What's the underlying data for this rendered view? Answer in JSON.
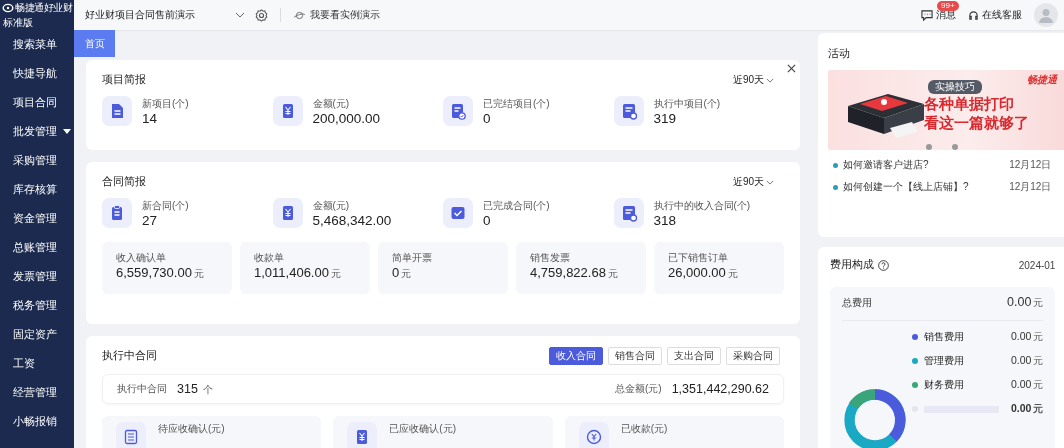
{
  "brand": {
    "name": "畅捷通好业财",
    "edition": "标准版"
  },
  "topbar": {
    "account": "好业财项目合同售前演示",
    "demo_link": "我要看实例演示",
    "messages": {
      "label": "消息",
      "badge": "99+"
    },
    "support": "在线客服"
  },
  "sidebar": {
    "items": [
      {
        "label": "搜索菜单",
        "expandable": false
      },
      {
        "label": "快捷导航",
        "expandable": false
      },
      {
        "label": "项目合同",
        "expandable": false
      },
      {
        "label": "批发管理",
        "expandable": true
      },
      {
        "label": "采购管理",
        "expandable": false
      },
      {
        "label": "库存核算",
        "expandable": false
      },
      {
        "label": "资金管理",
        "expandable": false
      },
      {
        "label": "总账管理",
        "expandable": false
      },
      {
        "label": "发票管理",
        "expandable": false
      },
      {
        "label": "税务管理",
        "expandable": false
      },
      {
        "label": "固定资产",
        "expandable": false
      },
      {
        "label": "工资",
        "expandable": false
      },
      {
        "label": "经营管理",
        "expandable": false
      },
      {
        "label": "小畅报销",
        "expandable": false
      }
    ]
  },
  "tabs": [
    {
      "label": "首页",
      "selected": true
    }
  ],
  "project_brief": {
    "title": "项目简报",
    "period": "近90天",
    "stats": [
      {
        "kind": "document",
        "label": "新项目(个)",
        "value": "14"
      },
      {
        "kind": "money",
        "label": "金额(元)",
        "value": "200,000.00"
      },
      {
        "kind": "checklist",
        "label": "已完结项目(个)",
        "value": "0"
      },
      {
        "kind": "form",
        "label": "执行中项目(个)",
        "value": "319"
      }
    ]
  },
  "contract_brief": {
    "title": "合同简报",
    "period": "近90天",
    "stats": [
      {
        "kind": "clipboard",
        "label": "新合同(个)",
        "value": "27"
      },
      {
        "kind": "money",
        "label": "金额(元)",
        "value": "5,468,342.00"
      },
      {
        "kind": "check",
        "label": "已完成合同(个)",
        "value": "0"
      },
      {
        "kind": "form",
        "label": "执行中的收入合同(个)",
        "value": "318"
      }
    ],
    "totals": [
      {
        "label": "收入确认单",
        "value": "6,559,730.00",
        "unit": "元"
      },
      {
        "label": "收款单",
        "value": "1,011,406.00",
        "unit": "元"
      },
      {
        "label": "简单开票",
        "value": "0",
        "unit": "元"
      },
      {
        "label": "销售发票",
        "value": "4,759,822.68",
        "unit": "元"
      },
      {
        "label": "已下销售订单",
        "value": "26,000.00",
        "unit": "元"
      }
    ]
  },
  "active_contracts": {
    "title": "执行中合同",
    "filters": [
      {
        "label": "收入合同",
        "selected": true
      },
      {
        "label": "销售合同",
        "selected": false
      },
      {
        "label": "支出合同",
        "selected": false
      },
      {
        "label": "采购合同",
        "selected": false
      }
    ],
    "count_label": "执行中合同",
    "count": "315",
    "count_unit": "个",
    "total_label": "总金额(元)",
    "total": "1,351,442,290.62",
    "tiles": [
      {
        "kind": "list",
        "label": "待应收确认(元)"
      },
      {
        "kind": "money",
        "label": "已应收确认(元)"
      },
      {
        "kind": "coin",
        "label": "已收款(元)"
      }
    ]
  },
  "activity": {
    "title": "活动",
    "banner": {
      "brand": "畅捷通",
      "tag": "实操技巧",
      "headline": [
        "各种单据打印",
        "看这一篇就够了"
      ]
    },
    "articles": [
      {
        "title": "如何邀请客户进店?",
        "date": "12月12日"
      },
      {
        "title": "如何创建一个【线上店铺】?",
        "date": "12月12日"
      }
    ]
  },
  "expenses": {
    "title": "费用构成",
    "period": "2024-01",
    "total_label": "总费用",
    "total": "0.00",
    "unit": "元",
    "items": [
      {
        "label": "销售费用",
        "value": "0.00",
        "unit": "元",
        "color": "#4b5bdc"
      },
      {
        "label": "管理费用",
        "value": "0.00",
        "unit": "元",
        "color": "#1aa9c4"
      },
      {
        "label": "财务费用",
        "value": "0.00",
        "unit": "元",
        "color": "#3aa57a"
      }
    ],
    "other": {
      "value": "0.00",
      "unit": "元"
    }
  }
}
